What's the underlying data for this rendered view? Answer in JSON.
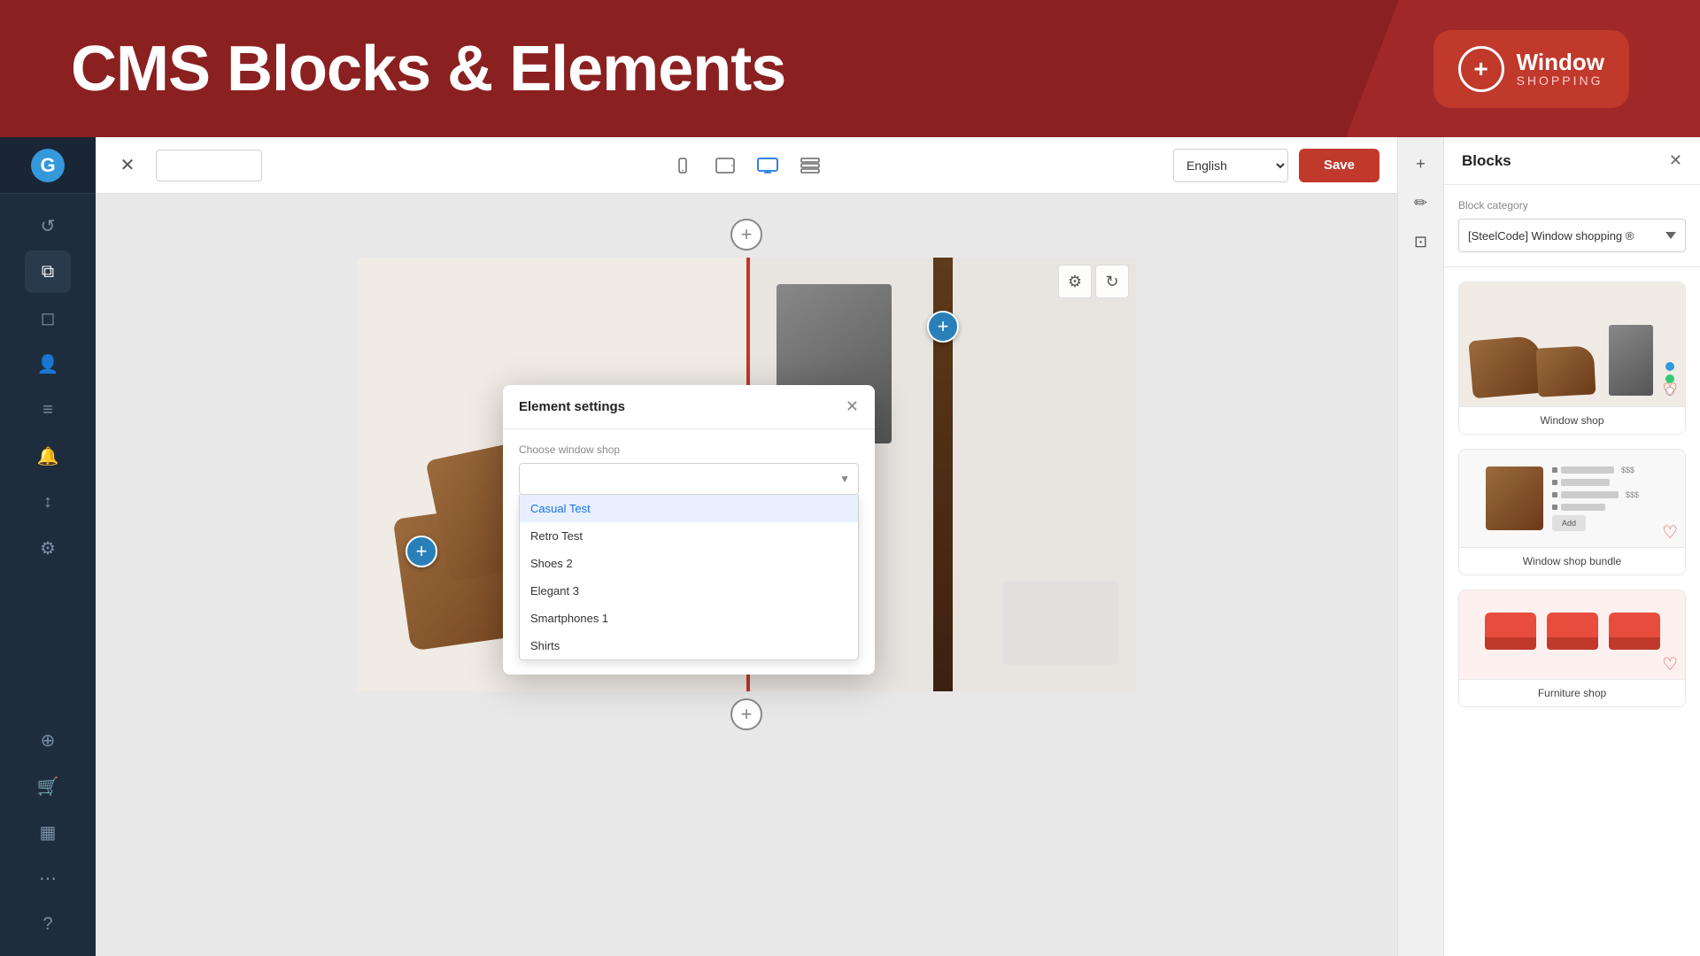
{
  "header": {
    "title": "CMS Blocks & Elements",
    "logo": {
      "icon": "+",
      "brand": "Window",
      "sub": "SHOPPING"
    }
  },
  "toolbar": {
    "close_icon": "✕",
    "input_placeholder": "",
    "devices": [
      {
        "icon": "📱",
        "label": "mobile",
        "active": false
      },
      {
        "icon": "⬜",
        "label": "tablet-portrait",
        "active": false
      },
      {
        "icon": "🖥",
        "label": "desktop",
        "active": true
      },
      {
        "icon": "☰",
        "label": "list",
        "active": false
      }
    ],
    "language": "English",
    "save_label": "Save"
  },
  "sidebar": {
    "logo": "G",
    "items": [
      {
        "icon": "↺",
        "label": "history",
        "active": false
      },
      {
        "icon": "⧉",
        "label": "layers",
        "active": false
      },
      {
        "icon": "◻",
        "label": "pages",
        "active": false
      },
      {
        "icon": "👤",
        "label": "users",
        "active": false
      },
      {
        "icon": "≡",
        "label": "content",
        "active": false
      },
      {
        "icon": "🔔",
        "label": "notifications",
        "active": false
      },
      {
        "icon": "↕",
        "label": "sync",
        "active": false
      },
      {
        "icon": "⚙",
        "label": "settings",
        "active": false
      }
    ],
    "bottom_items": [
      {
        "icon": "⊕",
        "label": "add"
      },
      {
        "icon": "🛒",
        "label": "shop"
      },
      {
        "icon": "▦",
        "label": "grid"
      },
      {
        "icon": "⋯",
        "label": "more"
      }
    ],
    "help_icon": "?"
  },
  "canvas": {
    "add_block_icon": "+",
    "settings_icon": "⚙",
    "refresh_icon": "↻"
  },
  "right_action_bar": {
    "items": [
      {
        "icon": "+",
        "label": "add"
      },
      {
        "icon": "✏",
        "label": "edit"
      },
      {
        "icon": "⊡",
        "label": "block"
      }
    ]
  },
  "blocks_panel": {
    "title": "Blocks",
    "close_icon": "✕",
    "category_label": "Block category",
    "category_value": "[SteelCode] Window shopping ®",
    "items": [
      {
        "label": "Window shop"
      },
      {
        "label": "Window shop bundle"
      },
      {
        "label": "Furniture shop"
      }
    ]
  },
  "modal": {
    "title": "Element settings",
    "close_icon": "✕",
    "field_label": "Choose window shop",
    "field_placeholder": "",
    "dropdown_arrow": "▼",
    "options": [
      {
        "label": "Casual Test",
        "selected": true
      },
      {
        "label": "Retro Test",
        "selected": false
      },
      {
        "label": "Shoes 2",
        "selected": false
      },
      {
        "label": "Elegant 3",
        "selected": false
      },
      {
        "label": "Smartphones 1",
        "selected": false
      },
      {
        "label": "Shirts",
        "selected": false
      }
    ]
  }
}
